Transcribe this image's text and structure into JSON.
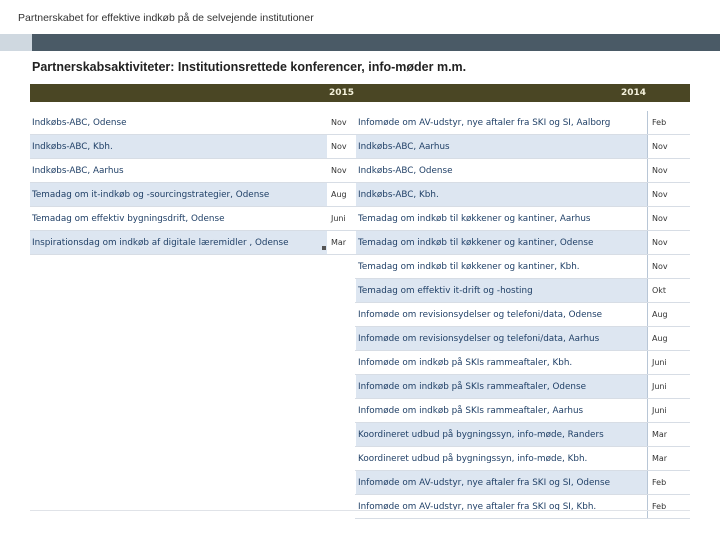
{
  "header": {
    "subtitle": "Partnerskabet for effektive indkøb på de selvejende institutioner"
  },
  "slide": {
    "title": "Partnerskabsaktiviteter: Institutionsrettede konferencer, info-møder m.m."
  },
  "table": {
    "year_left": "2015",
    "year_right": "2014",
    "left_rows": [
      {
        "name": "Indkøbs-ABC, Odense",
        "month": "Nov",
        "shaded": false
      },
      {
        "name": "Indkøbs-ABC, Kbh.",
        "month": "Nov",
        "shaded": true
      },
      {
        "name": "Indkøbs-ABC, Aarhus",
        "month": "Nov",
        "shaded": false
      },
      {
        "name": "Temadag om it-indkøb og -sourcingstrategier, Odense",
        "month": "Aug",
        "shaded": true
      },
      {
        "name": "Temadag om effektiv bygningsdrift, Odense",
        "month": "Juni",
        "shaded": false
      },
      {
        "name": "Inspirationsdag om indkøb af digitale læremidler , Odense",
        "month": "Mar",
        "shaded": true
      }
    ],
    "right_rows": [
      {
        "name": "Infomøde om AV-udstyr, nye aftaler fra SKI og SI, Aalborg",
        "month": "Feb",
        "shaded": false
      },
      {
        "name": "Indkøbs-ABC, Aarhus",
        "month": "Nov",
        "shaded": true
      },
      {
        "name": "Indkøbs-ABC, Odense",
        "month": "Nov",
        "shaded": false
      },
      {
        "name": "Indkøbs-ABC, Kbh.",
        "month": "Nov",
        "shaded": true
      },
      {
        "name": "Temadag om indkøb til køkkener og kantiner, Aarhus",
        "month": "Nov",
        "shaded": false
      },
      {
        "name": "Temadag om indkøb til køkkener og kantiner, Odense",
        "month": "Nov",
        "shaded": true
      },
      {
        "name": "Temadag om indkøb til køkkener og kantiner, Kbh.",
        "month": "Nov",
        "shaded": false
      },
      {
        "name": "Temadag om effektiv it-drift og -hosting",
        "month": "Okt",
        "shaded": true
      },
      {
        "name": "Infomøde om revisionsydelser og telefoni/data, Odense",
        "month": "Aug",
        "shaded": false
      },
      {
        "name": "Infomøde om revisionsydelser og telefoni/data, Aarhus",
        "month": "Aug",
        "shaded": true
      },
      {
        "name": "Infomøde om indkøb på SKIs rammeaftaler, Kbh.",
        "month": "Juni",
        "shaded": false
      },
      {
        "name": "Infomøde om indkøb på SKIs rammeaftaler, Odense",
        "month": "Juni",
        "shaded": true
      },
      {
        "name": "Infomøde om indkøb på SKIs rammeaftaler, Aarhus",
        "month": "Juni",
        "shaded": false
      },
      {
        "name": "Koordineret udbud på bygningssyn, info-møde, Randers",
        "month": "Mar",
        "shaded": true
      },
      {
        "name": "Koordineret udbud på bygningssyn, info-møde, Kbh.",
        "month": "Mar",
        "shaded": false
      },
      {
        "name": "Infomøde om AV-udstyr, nye aftaler fra SKI og SI, Odense",
        "month": "Feb",
        "shaded": true
      },
      {
        "name": "Infomøde om AV-udstyr, nye aftaler fra SKI og SI, Kbh.",
        "month": "Feb",
        "shaded": false
      }
    ]
  }
}
